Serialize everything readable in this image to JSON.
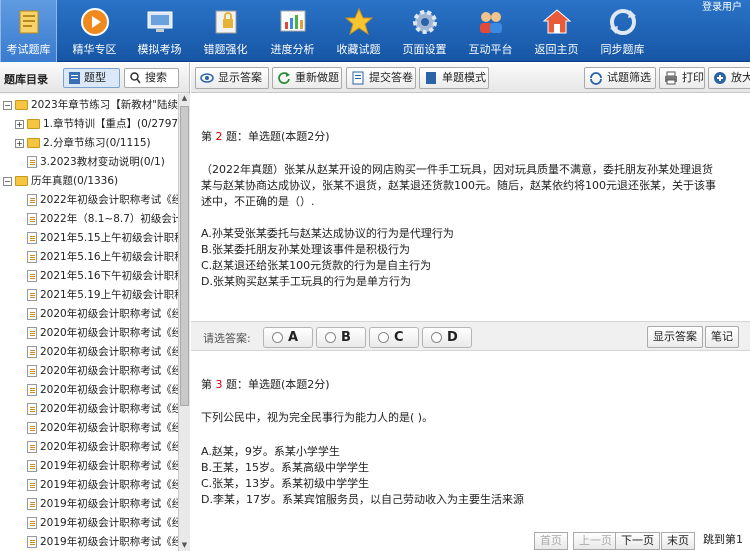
{
  "topbar": {
    "login_text": "登录用户",
    "tools": [
      {
        "label": "考试题库",
        "icon": "book-icon"
      },
      {
        "label": "精华专区",
        "icon": "play-icon"
      },
      {
        "label": "模拟考场",
        "icon": "monitor-icon"
      },
      {
        "label": "错题强化",
        "icon": "lock-icon"
      },
      {
        "label": "进度分析",
        "icon": "chart-icon"
      },
      {
        "label": "收藏试题",
        "icon": "star-icon"
      },
      {
        "label": "页面设置",
        "icon": "gear-icon"
      },
      {
        "label": "互动平台",
        "icon": "users-icon"
      },
      {
        "label": "返回主页",
        "icon": "home-icon"
      },
      {
        "label": "同步题库",
        "icon": "sync-icon"
      }
    ]
  },
  "left": {
    "title": "题库目录",
    "btn_questions": "题型",
    "btn_search": "搜索",
    "tree": [
      {
        "level": 0,
        "type": "folder",
        "toggle": "−",
        "label": "2023年章节练习【新教材\"陆续更"
      },
      {
        "level": 1,
        "type": "folder",
        "toggle": "+",
        "label": "1.章节特训【重点】(0/2797"
      },
      {
        "level": 1,
        "type": "folder",
        "toggle": "+",
        "label": "2.分章节练习(0/1115)"
      },
      {
        "level": 1,
        "type": "doc",
        "toggle": "",
        "label": "3.2023教材变动说明(0/1)"
      },
      {
        "level": 0,
        "type": "folder",
        "toggle": "−",
        "label": "历年真题(0/1336)"
      },
      {
        "level": 1,
        "type": "doc",
        "toggle": "",
        "label": "2022年初级会计职称考试《经"
      },
      {
        "level": 1,
        "type": "doc",
        "toggle": "",
        "label": "2022年（8.1~8.7）初级会计"
      },
      {
        "level": 1,
        "type": "doc",
        "toggle": "",
        "label": "2021年5.15上午初级会计职称"
      },
      {
        "level": 1,
        "type": "doc",
        "toggle": "",
        "label": "2021年5.16上午初级会计职称"
      },
      {
        "level": 1,
        "type": "doc",
        "toggle": "",
        "label": "2021年5.16下午初级会计职称"
      },
      {
        "level": 1,
        "type": "doc",
        "toggle": "",
        "label": "2021年5.19上午初级会计职称"
      },
      {
        "level": 1,
        "type": "doc",
        "toggle": "",
        "label": "2020年初级会计职称考试《经"
      },
      {
        "level": 1,
        "type": "doc",
        "toggle": "",
        "label": "2020年初级会计职称考试《经"
      },
      {
        "level": 1,
        "type": "doc",
        "toggle": "",
        "label": "2020年初级会计职称考试《经"
      },
      {
        "level": 1,
        "type": "doc",
        "toggle": "",
        "label": "2020年初级会计职称考试《经"
      },
      {
        "level": 1,
        "type": "doc",
        "toggle": "",
        "label": "2020年初级会计职称考试《经"
      },
      {
        "level": 1,
        "type": "doc",
        "toggle": "",
        "label": "2020年初级会计职称考试《经"
      },
      {
        "level": 1,
        "type": "doc",
        "toggle": "",
        "label": "2020年初级会计职称考试《经"
      },
      {
        "level": 1,
        "type": "doc",
        "toggle": "",
        "label": "2020年初级会计职称考试《经"
      },
      {
        "level": 1,
        "type": "doc",
        "toggle": "",
        "label": "2019年初级会计职称考试《经"
      },
      {
        "level": 1,
        "type": "doc",
        "toggle": "",
        "label": "2019年初级会计职称考试《经"
      },
      {
        "level": 1,
        "type": "doc",
        "toggle": "",
        "label": "2019年初级会计职称考试《经"
      },
      {
        "level": 1,
        "type": "doc",
        "toggle": "",
        "label": "2019年初级会计职称考试《经"
      },
      {
        "level": 1,
        "type": "doc",
        "toggle": "",
        "label": "2019年初级会计职称考试《经"
      }
    ]
  },
  "main": {
    "toolbar": {
      "show_answer": "显示答案",
      "redo": "重新做题",
      "submit": "提交答卷",
      "single_mode": "单题模式",
      "filter": "试题筛选",
      "print": "打印",
      "zoom": "放大"
    },
    "q2": {
      "prefix": "第 ",
      "num": "2",
      "suffix": " 题：单选题(本题2分)",
      "stem_line1": "（2022年真题）张某从赵某开设的网店购买一件手工玩具，因对玩具质量不满意，委托朋友孙某处理退货",
      "stem_line2": "某与赵某协商达成协议，张某不退货，赵某退还货款100元。随后，赵某依约将100元退还张某，关于该事",
      "stem_line3": "述中，不正确的是（）.",
      "options": [
        "A.孙某受张某委托与赵某达成协议的行为是代理行为",
        "B.张某委托朋友孙某处理该事件是积极行为",
        "C.赵某退还给张某100元货款的行为是自主行为",
        "D.张某购买赵某手工玩具的行为是单方行为"
      ]
    },
    "answer_bar": {
      "label": "请选答案:",
      "choices": [
        "A",
        "B",
        "C",
        "D"
      ],
      "show_answer": "显示答案",
      "note": "笔记"
    },
    "q3": {
      "prefix": "第 ",
      "num": "3",
      "suffix": " 题：单选题(本题2分)",
      "stem": "下列公民中，视为完全民事行为能力人的是( )。",
      "options": [
        "A.赵某，9岁。系某小学学生",
        "B.王某，15岁。系某高级中学学生",
        "C.张某，13岁。系某初级中学学生",
        "D.李某，17岁。系某宾馆服务员，以自己劳动收入为主要生活来源"
      ]
    },
    "pager": {
      "first": "首页",
      "prev": "上一页",
      "next": "下一页",
      "last": "末页",
      "jump": "跳到第1"
    }
  }
}
